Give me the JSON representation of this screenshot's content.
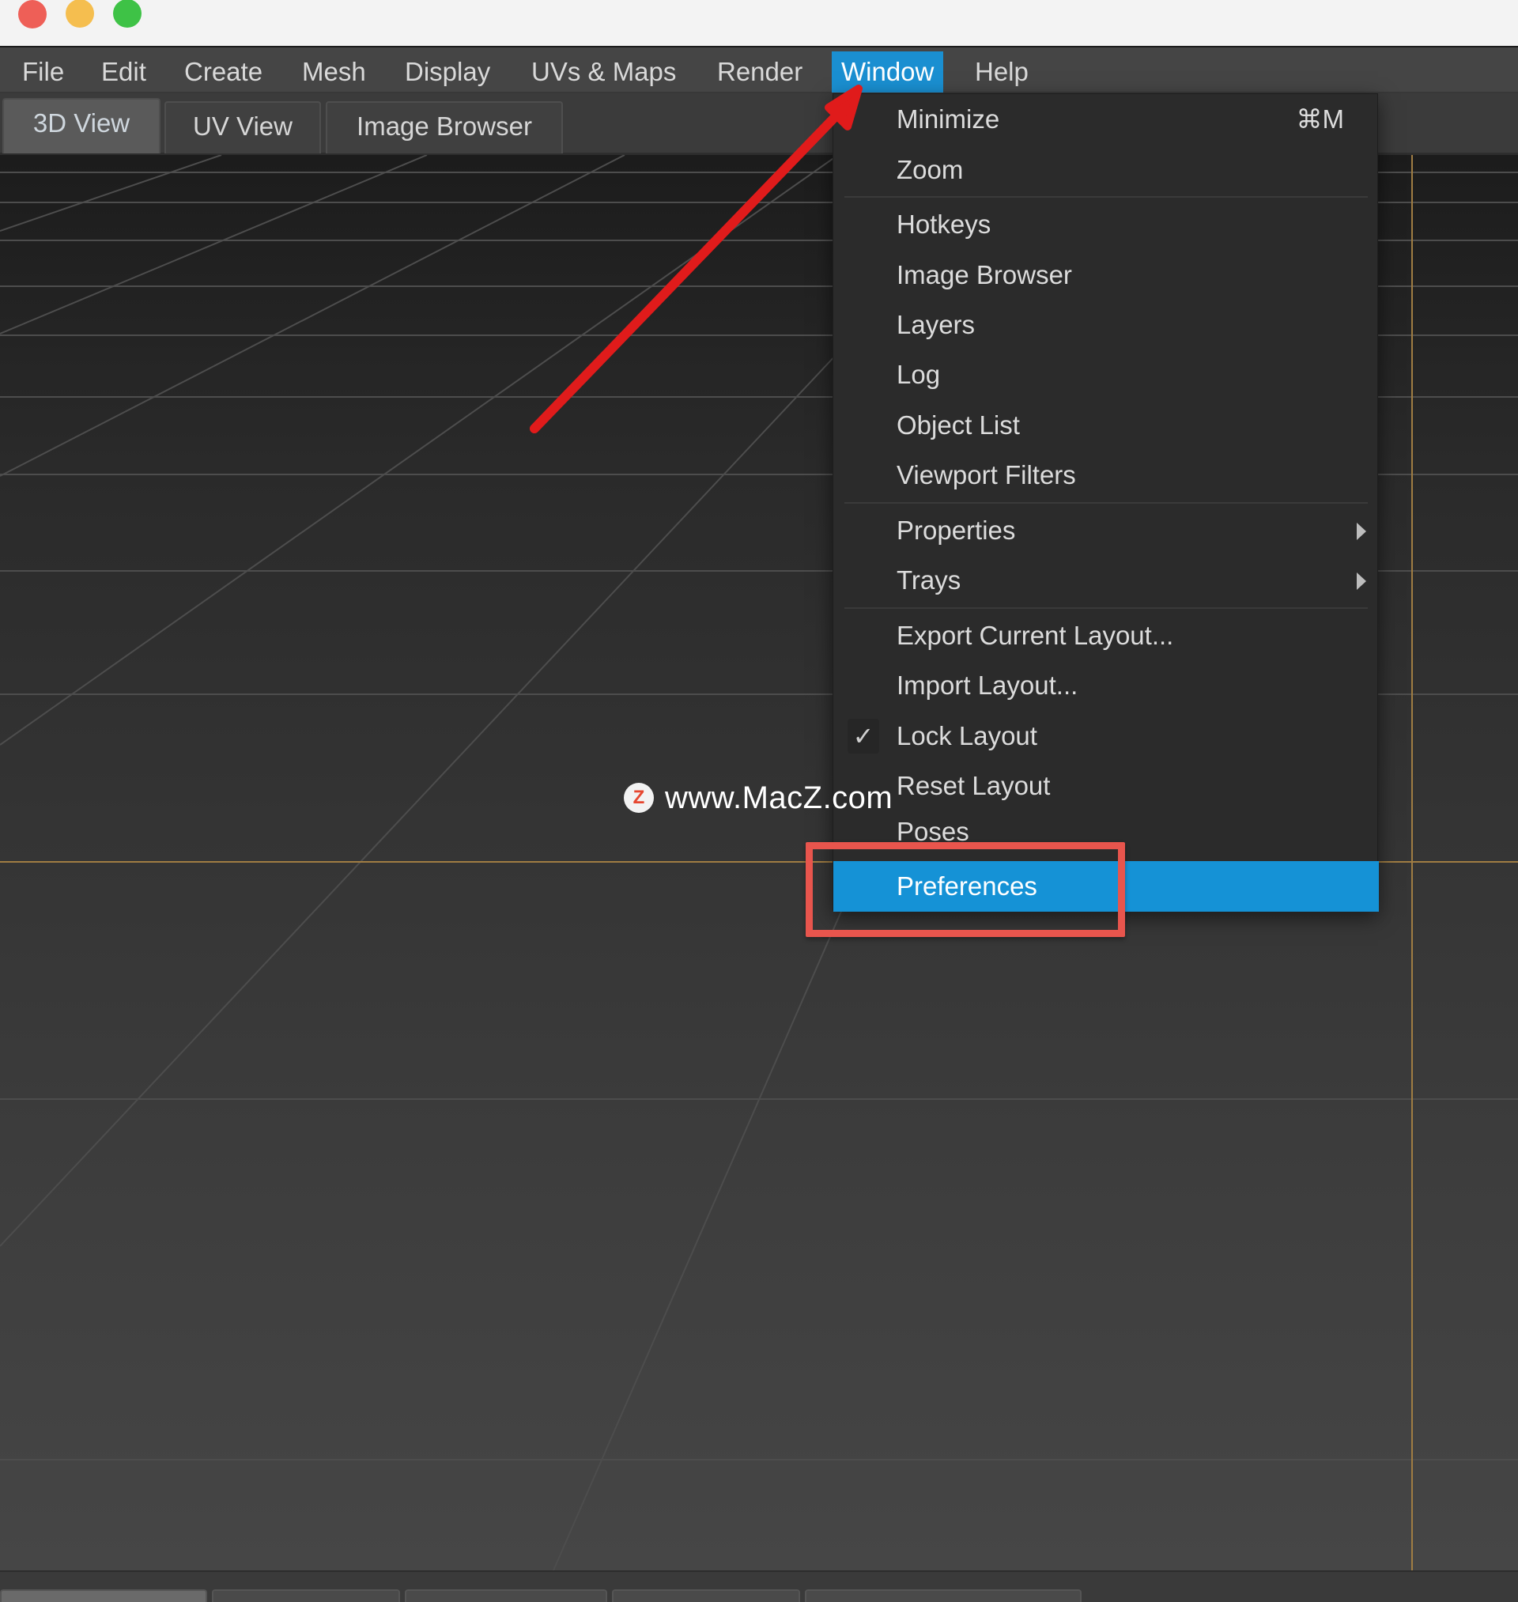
{
  "menubar": {
    "items": [
      "File",
      "Edit",
      "Create",
      "Mesh",
      "Display",
      "UVs & Maps",
      "Render",
      "Window",
      "Help"
    ],
    "active": "Window"
  },
  "tabs": {
    "items": [
      "3D View",
      "UV View",
      "Image Browser"
    ],
    "selected": "3D View"
  },
  "window_menu": {
    "minimize": "Minimize",
    "minimize_shortcut": "⌘M",
    "zoom": "Zoom",
    "hotkeys": "Hotkeys",
    "image_browser": "Image Browser",
    "layers": "Layers",
    "log": "Log",
    "object_list": "Object List",
    "viewport_filters": "Viewport Filters",
    "properties": "Properties",
    "trays": "Trays",
    "export_layout": "Export Current Layout...",
    "import_layout": "Import Layout...",
    "lock_layout": "Lock Layout",
    "lock_layout_checked": true,
    "check_mark": "✓",
    "reset_layout": "Reset Layout",
    "poses": "Poses",
    "preferences": "Preferences",
    "highlighted": "Preferences"
  },
  "watermark": {
    "logo": "Z",
    "text": "www.MacZ.com"
  },
  "colors": {
    "menu_highlight": "#1592d6",
    "annotation_red": "#e8554d",
    "arrow_red": "#e01b1b",
    "grid_axis": "#a07d43"
  }
}
